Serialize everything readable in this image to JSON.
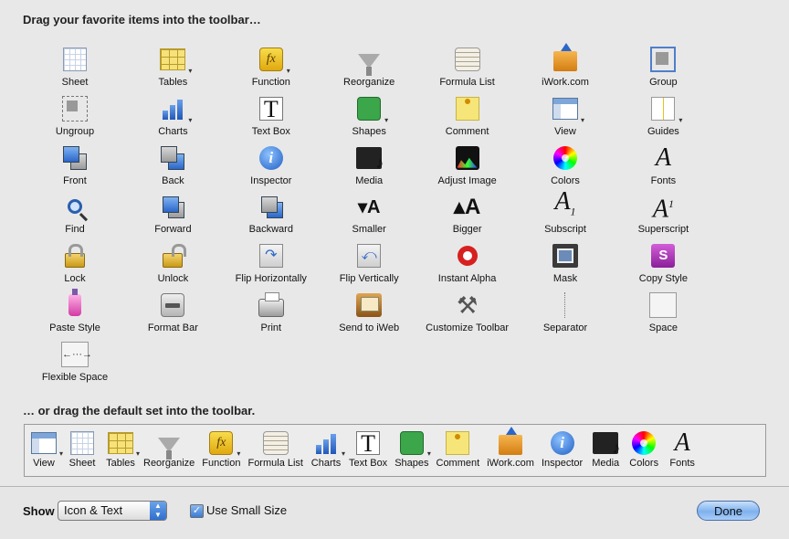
{
  "heading_top": "Drag your favorite items into the toolbar…",
  "heading_bottom": "… or drag the default set into the toolbar.",
  "items": [
    {
      "label": "Sheet",
      "icon": "sheet-icon"
    },
    {
      "label": "Tables",
      "icon": "tables-icon"
    },
    {
      "label": "Function",
      "icon": "function-icon"
    },
    {
      "label": "Reorganize",
      "icon": "reorganize-icon"
    },
    {
      "label": "Formula List",
      "icon": "formula-list-icon"
    },
    {
      "label": "iWork.com",
      "icon": "iwork-icon"
    },
    {
      "label": "Group",
      "icon": "group-icon"
    },
    {
      "label": "Ungroup",
      "icon": "ungroup-icon"
    },
    {
      "label": "Charts",
      "icon": "charts-icon"
    },
    {
      "label": "Text Box",
      "icon": "text-box-icon"
    },
    {
      "label": "Shapes",
      "icon": "shapes-icon"
    },
    {
      "label": "Comment",
      "icon": "comment-icon"
    },
    {
      "label": "View",
      "icon": "view-icon"
    },
    {
      "label": "Guides",
      "icon": "guides-icon"
    },
    {
      "label": "Front",
      "icon": "front-icon"
    },
    {
      "label": "Back",
      "icon": "back-icon"
    },
    {
      "label": "Inspector",
      "icon": "inspector-icon"
    },
    {
      "label": "Media",
      "icon": "media-icon"
    },
    {
      "label": "Adjust Image",
      "icon": "adjust-image-icon"
    },
    {
      "label": "Colors",
      "icon": "colors-icon"
    },
    {
      "label": "Fonts",
      "icon": "fonts-icon"
    },
    {
      "label": "Find",
      "icon": "find-icon"
    },
    {
      "label": "Forward",
      "icon": "forward-icon"
    },
    {
      "label": "Backward",
      "icon": "backward-icon"
    },
    {
      "label": "Smaller",
      "icon": "smaller-icon"
    },
    {
      "label": "Bigger",
      "icon": "bigger-icon"
    },
    {
      "label": "Subscript",
      "icon": "subscript-icon"
    },
    {
      "label": "Superscript",
      "icon": "superscript-icon"
    },
    {
      "label": "Lock",
      "icon": "lock-icon"
    },
    {
      "label": "Unlock",
      "icon": "unlock-icon"
    },
    {
      "label": "Flip Horizontally",
      "icon": "flip-horizontally-icon"
    },
    {
      "label": "Flip Vertically",
      "icon": "flip-vertically-icon"
    },
    {
      "label": "Instant Alpha",
      "icon": "instant-alpha-icon"
    },
    {
      "label": "Mask",
      "icon": "mask-icon"
    },
    {
      "label": "Copy Style",
      "icon": "copy-style-icon"
    },
    {
      "label": "Paste Style",
      "icon": "paste-style-icon"
    },
    {
      "label": "Format Bar",
      "icon": "format-bar-icon"
    },
    {
      "label": "Print",
      "icon": "print-icon"
    },
    {
      "label": "Send to iWeb",
      "icon": "send-to-iweb-icon"
    },
    {
      "label": "Customize Toolbar",
      "icon": "customize-toolbar-icon"
    },
    {
      "label": "Separator",
      "icon": "separator-icon"
    },
    {
      "label": "Space",
      "icon": "space-icon"
    },
    {
      "label": "Flexible Space",
      "icon": "flexible-space-icon"
    }
  ],
  "default_set": [
    {
      "label": "View",
      "icon": "view-icon"
    },
    {
      "label": "Sheet",
      "icon": "sheet-icon"
    },
    {
      "label": "Tables",
      "icon": "tables-icon"
    },
    {
      "label": "Reorganize",
      "icon": "reorganize-icon"
    },
    {
      "label": "Function",
      "icon": "function-icon"
    },
    {
      "label": "Formula List",
      "icon": "formula-list-icon"
    },
    {
      "label": "Charts",
      "icon": "charts-icon"
    },
    {
      "label": "Text Box",
      "icon": "text-box-icon"
    },
    {
      "label": "Shapes",
      "icon": "shapes-icon"
    },
    {
      "label": "Comment",
      "icon": "comment-icon"
    },
    {
      "label": "iWork.com",
      "icon": "iwork-icon"
    },
    {
      "label": "Inspector",
      "icon": "inspector-icon"
    },
    {
      "label": "Media",
      "icon": "media-icon"
    },
    {
      "label": "Colors",
      "icon": "colors-icon"
    },
    {
      "label": "Fonts",
      "icon": "fonts-icon"
    }
  ],
  "footer": {
    "show_label": "Show",
    "show_value": "Icon & Text",
    "small_size_label": "Use Small Size",
    "small_size_checked": true,
    "done_label": "Done"
  },
  "colors": {
    "accent": "#2b67c9",
    "window_bg": "#e8e8e8"
  }
}
